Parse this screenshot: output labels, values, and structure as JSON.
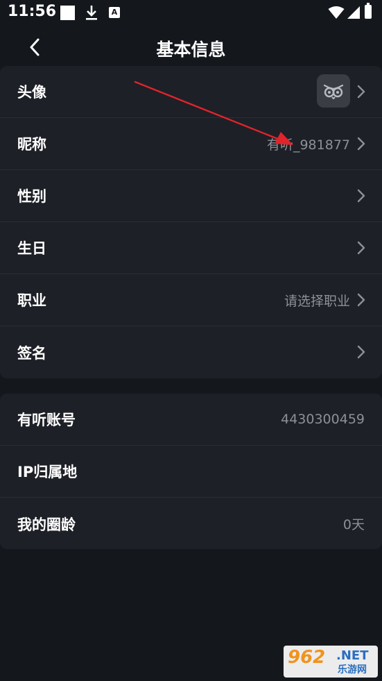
{
  "status_bar": {
    "time": "11:56",
    "notification_badge": "A"
  },
  "header": {
    "title": "基本信息"
  },
  "profile_section": {
    "rows": [
      {
        "label": "头像",
        "value": "",
        "icon": "owl-avatar-icon"
      },
      {
        "label": "昵称",
        "value": "有听_981877"
      },
      {
        "label": "性别",
        "value": ""
      },
      {
        "label": "生日",
        "value": ""
      },
      {
        "label": "职业",
        "value": "请选择职业"
      },
      {
        "label": "签名",
        "value": ""
      }
    ]
  },
  "account_section": {
    "rows": [
      {
        "label": "有听账号",
        "value": "4430300459"
      },
      {
        "label": "IP归属地",
        "value": ""
      },
      {
        "label": "我的圈龄",
        "value": "0天"
      }
    ]
  },
  "watermark": {
    "num": "962",
    "net": ".NET",
    "cn": "乐游网"
  },
  "colors": {
    "background": "#14171c",
    "card": "#1d2026",
    "value_text": "#8d9096",
    "annotation_arrow": "#e0242b"
  }
}
